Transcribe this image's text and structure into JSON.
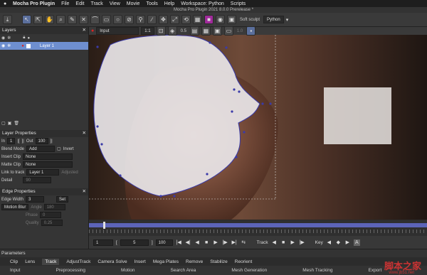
{
  "menubar": {
    "app": "Mocha Pro Plugin",
    "items": [
      "File",
      "Edit",
      "Track",
      "View",
      "Movie",
      "Tools",
      "Help",
      "Workspace: Python",
      "Scripts"
    ]
  },
  "window_title": "Mocha Pro Plugin 2021 8.0.0 Prerelease *",
  "toolbar": {
    "soft_sculpt": "Soft sculpt",
    "language": "Python"
  },
  "viewer_bar": {
    "clip": "Input",
    "zoom": "1:1",
    "opacity": "0.5",
    "frame_value": "1.0"
  },
  "layers": {
    "title": "Layers",
    "row": "Layer 1"
  },
  "layer_properties": {
    "title": "Layer Properties",
    "in_label": "In",
    "in_value": "1",
    "out_label": "Out",
    "out_value": "100",
    "blend_mode_label": "Blend Mode",
    "blend_mode_value": "Add",
    "invert_label": "Invert",
    "insert_clip_label": "Insert Clip",
    "insert_clip_value": "None",
    "matte_clip_label": "Matte Clip",
    "matte_clip_value": "None",
    "link_label": "Link to track",
    "link_value": "Layer 1",
    "adjusted": "Adjusted",
    "detail_label": "Detail",
    "detail_value": "90"
  },
  "edge_properties": {
    "title": "Edge Properties",
    "width_label": "Edge Width",
    "width_value": "3",
    "set_label": "Set",
    "motion_blur": "Motion Blur",
    "angle_label": "Angle",
    "angle_value": "180",
    "phase_label": "Phase",
    "phase_value": "0",
    "quality_label": "Quality",
    "quality_value": "0.25"
  },
  "transport": {
    "frame_start": "1",
    "current": "5",
    "frame_end": "100",
    "track_label": "Track",
    "key_label": "Key"
  },
  "parameters": {
    "title": "Parameters",
    "tabs": [
      "Clip",
      "Lens",
      "Track",
      "AdjustTrack",
      "Camera Solve",
      "Insert",
      "Mega Plates",
      "Remove",
      "Stabilize",
      "Reorient"
    ],
    "sections": [
      "Input",
      "Preprocessing",
      "Motion",
      "Search Area",
      "Mesh Generation",
      "Mesh Tracking",
      "Export"
    ]
  },
  "watermark": {
    "text": "脚本之家",
    "url": "www.jb51.net"
  },
  "colors": {
    "accent": "#6e8fd0",
    "timeline": "#5c64b8",
    "spline": "#3a3aa8"
  }
}
